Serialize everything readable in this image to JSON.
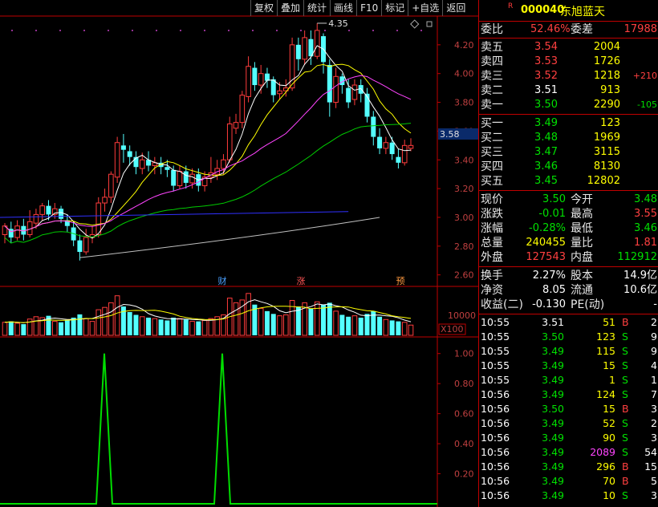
{
  "toolbar": [
    "复权",
    "叠加",
    "统计",
    "画线",
    "F10",
    "标记",
    "+自选",
    "返回"
  ],
  "stock": {
    "r_mark": "R",
    "code": "000040",
    "name": "东旭蓝天"
  },
  "order_ratio": {
    "wb_label": "委比",
    "wb_value": "52.46%",
    "wc_label": "委差",
    "wc_value": "17988"
  },
  "asks": [
    {
      "label": "卖五",
      "price": "3.54",
      "vol": "2004",
      "chg": ""
    },
    {
      "label": "卖四",
      "price": "3.53",
      "vol": "1726",
      "chg": ""
    },
    {
      "label": "卖三",
      "price": "3.52",
      "vol": "1218",
      "chg": "+210"
    },
    {
      "label": "卖二",
      "price": "3.51",
      "vol": "913",
      "chg": ""
    },
    {
      "label": "卖一",
      "price": "3.50",
      "vol": "2290",
      "chg": "-105"
    }
  ],
  "bids": [
    {
      "label": "买一",
      "price": "3.49",
      "vol": "123"
    },
    {
      "label": "买二",
      "price": "3.48",
      "vol": "1969"
    },
    {
      "label": "买三",
      "price": "3.47",
      "vol": "3115"
    },
    {
      "label": "买四",
      "price": "3.46",
      "vol": "8130"
    },
    {
      "label": "买五",
      "price": "3.45",
      "vol": "12802"
    }
  ],
  "quote": [
    {
      "l1": "现价",
      "v1": "3.50",
      "l2": "今开",
      "v2": "3.48"
    },
    {
      "l1": "涨跌",
      "v1": "-0.01",
      "l2": "最高",
      "v2": "3.55"
    },
    {
      "l1": "涨幅",
      "v1": "-0.28%",
      "l2": "最低",
      "v2": "3.46"
    },
    {
      "l1": "总量",
      "v1": "240455",
      "l2": "量比",
      "v2": "1.81"
    },
    {
      "l1": "外盘",
      "v1": "127543",
      "l2": "内盘",
      "v2": "112912"
    }
  ],
  "stats": [
    {
      "l1": "换手",
      "v1": "2.27%",
      "l2": "股本",
      "v2": "14.9亿"
    },
    {
      "l1": "净资",
      "v1": "8.05",
      "l2": "流通",
      "v2": "10.6亿"
    },
    {
      "l1": "收益(二)",
      "v1": "-0.130",
      "l2": "PE(动)",
      "v2": "-"
    }
  ],
  "ticks": [
    {
      "time": "10:55",
      "price": "3.51",
      "vol": "51",
      "dir": "B",
      "n": "2"
    },
    {
      "time": "10:55",
      "price": "3.50",
      "vol": "123",
      "dir": "S",
      "n": "9"
    },
    {
      "time": "10:55",
      "price": "3.49",
      "vol": "115",
      "dir": "S",
      "n": "9"
    },
    {
      "time": "10:55",
      "price": "3.49",
      "vol": "15",
      "dir": "S",
      "n": "4"
    },
    {
      "time": "10:55",
      "price": "3.49",
      "vol": "1",
      "dir": "S",
      "n": "1"
    },
    {
      "time": "10:56",
      "price": "3.49",
      "vol": "124",
      "dir": "S",
      "n": "7"
    },
    {
      "time": "10:56",
      "price": "3.50",
      "vol": "15",
      "dir": "B",
      "n": "3"
    },
    {
      "time": "10:56",
      "price": "3.49",
      "vol": "52",
      "dir": "S",
      "n": "2"
    },
    {
      "time": "10:56",
      "price": "3.49",
      "vol": "90",
      "dir": "S",
      "n": "3"
    },
    {
      "time": "10:56",
      "price": "3.49",
      "vol": "2089",
      "dir": "S",
      "n": "54"
    },
    {
      "time": "10:56",
      "price": "3.49",
      "vol": "296",
      "dir": "B",
      "n": "15"
    },
    {
      "time": "10:56",
      "price": "3.49",
      "vol": "70",
      "dir": "B",
      "n": "5"
    },
    {
      "time": "10:56",
      "price": "3.49",
      "vol": "10",
      "dir": "S",
      "n": "3"
    }
  ],
  "chart_data": {
    "type": "candlestick",
    "price_axis": {
      "ticks": [
        "4.20",
        "4.00",
        "3.80",
        "3.60",
        "3.40",
        "3.20",
        "3.00",
        "2.80",
        "2.60"
      ],
      "range": [
        2.52,
        4.4
      ],
      "current_price_label": "3.58"
    },
    "max_label": "4.35",
    "event_markers": [
      "财",
      "涨",
      "预"
    ],
    "volume_axis": {
      "tick": "10000",
      "unit": "X100"
    },
    "indicator_axis": {
      "ticks": [
        "1.00",
        "0.80",
        "0.60",
        "0.40",
        "0.20"
      ],
      "range": [
        0,
        1.1
      ]
    },
    "candles": [
      [
        2.88,
        2.94,
        2.82,
        2.96
      ],
      [
        2.92,
        2.86,
        2.82,
        2.97
      ],
      [
        2.86,
        2.94,
        2.84,
        2.98
      ],
      [
        2.94,
        2.88,
        2.84,
        2.99
      ],
      [
        2.88,
        2.97,
        2.86,
        3.05
      ],
      [
        2.96,
        3.02,
        2.92,
        3.06
      ],
      [
        3.02,
        3.08,
        2.98,
        3.1
      ],
      [
        3.08,
        3.02,
        2.98,
        3.12
      ],
      [
        3.02,
        3.06,
        2.99,
        3.1
      ],
      [
        3.06,
        2.99,
        2.96,
        3.08
      ],
      [
        2.98,
        2.94,
        2.9,
        3.02
      ],
      [
        2.93,
        2.84,
        2.8,
        2.97
      ],
      [
        2.84,
        2.76,
        2.7,
        2.88
      ],
      [
        2.76,
        2.86,
        2.74,
        2.92
      ],
      [
        2.86,
        2.88,
        2.82,
        2.94
      ],
      [
        2.88,
        3.1,
        2.86,
        3.14
      ],
      [
        3.1,
        3.14,
        3.04,
        3.2
      ],
      [
        3.14,
        3.3,
        3.1,
        3.32
      ],
      [
        3.28,
        3.52,
        3.24,
        3.56
      ],
      [
        3.5,
        3.47,
        3.38,
        3.58
      ],
      [
        3.46,
        3.42,
        3.36,
        3.5
      ],
      [
        3.42,
        3.35,
        3.3,
        3.46
      ],
      [
        3.34,
        3.4,
        3.3,
        3.45
      ],
      [
        3.4,
        3.36,
        3.32,
        3.46
      ],
      [
        3.36,
        3.38,
        3.3,
        3.42
      ],
      [
        3.38,
        3.35,
        3.3,
        3.42
      ],
      [
        3.35,
        3.33,
        3.28,
        3.4
      ],
      [
        3.33,
        3.22,
        3.18,
        3.36
      ],
      [
        3.22,
        3.32,
        3.2,
        3.36
      ],
      [
        3.32,
        3.24,
        3.2,
        3.36
      ],
      [
        3.24,
        3.3,
        3.2,
        3.34
      ],
      [
        3.3,
        3.22,
        3.18,
        3.34
      ],
      [
        3.22,
        3.28,
        3.18,
        3.32
      ],
      [
        3.28,
        3.31,
        3.24,
        3.42
      ],
      [
        3.3,
        3.34,
        3.26,
        3.4
      ],
      [
        3.34,
        3.4,
        3.3,
        3.44
      ],
      [
        3.4,
        3.65,
        3.38,
        3.7
      ],
      [
        3.62,
        3.66,
        3.58,
        3.72
      ],
      [
        3.66,
        3.85,
        3.62,
        3.88
      ],
      [
        3.84,
        4.05,
        3.8,
        4.12
      ],
      [
        4.04,
        3.92,
        3.88,
        4.08
      ],
      [
        3.92,
        4.0,
        3.86,
        4.06
      ],
      [
        4.0,
        3.95,
        3.9,
        4.04
      ],
      [
        3.96,
        3.85,
        3.8,
        3.98
      ],
      [
        3.86,
        3.88,
        3.82,
        3.94
      ],
      [
        3.88,
        3.9,
        3.84,
        3.96
      ],
      [
        3.9,
        4.2,
        3.88,
        4.25
      ],
      [
        4.2,
        4.1,
        4.02,
        4.25
      ],
      [
        4.1,
        4.25,
        4.06,
        4.3
      ],
      [
        4.24,
        4.12,
        4.06,
        4.3
      ],
      [
        4.12,
        4.3,
        4.1,
        4.35
      ],
      [
        4.26,
        4.08,
        4.0,
        4.28
      ],
      [
        4.06,
        3.8,
        3.7,
        4.1
      ],
      [
        3.8,
        3.98,
        3.76,
        4.04
      ],
      [
        3.98,
        3.92,
        3.86,
        4.0
      ],
      [
        3.9,
        3.8,
        3.76,
        3.96
      ],
      [
        3.82,
        3.92,
        3.78,
        3.96
      ],
      [
        3.92,
        3.86,
        3.8,
        3.96
      ],
      [
        3.86,
        3.7,
        3.66,
        3.9
      ],
      [
        3.7,
        3.56,
        3.5,
        3.74
      ],
      [
        3.56,
        3.48,
        3.44,
        3.62
      ],
      [
        3.48,
        3.52,
        3.44,
        3.56
      ],
      [
        3.52,
        3.44,
        3.4,
        3.56
      ],
      [
        3.42,
        3.38,
        3.34,
        3.48
      ],
      [
        3.38,
        3.5,
        3.36,
        3.54
      ],
      [
        3.48,
        3.5,
        3.46,
        3.55
      ]
    ],
    "volumes": [
      28,
      30,
      26,
      24,
      35,
      40,
      38,
      42,
      30,
      28,
      32,
      38,
      45,
      36,
      30,
      55,
      60,
      70,
      85,
      62,
      50,
      44,
      40,
      38,
      36,
      34,
      32,
      38,
      36,
      34,
      30,
      30,
      32,
      36,
      40,
      44,
      80,
      70,
      76,
      90,
      66,
      58,
      52,
      46,
      42,
      44,
      75,
      62,
      70,
      58,
      72,
      66,
      70,
      52,
      44,
      40,
      42,
      38,
      46,
      52,
      40,
      34,
      32,
      30,
      28,
      22
    ],
    "indicator": {
      "values": [
        0,
        0,
        0,
        0,
        0,
        0,
        0,
        0,
        0,
        0,
        0,
        0,
        0,
        0,
        0,
        0,
        0,
        0,
        0,
        0,
        0,
        0,
        0,
        0,
        0,
        0,
        0,
        0,
        0,
        0,
        0,
        0,
        0,
        0,
        0,
        0,
        0,
        1,
        0,
        0,
        0,
        0,
        0,
        0,
        0,
        0,
        0,
        0,
        0,
        0,
        0,
        0,
        0,
        0,
        0,
        0,
        0,
        0,
        0,
        0,
        0,
        0,
        0,
        0,
        0,
        0
      ],
      "spikes_at_index": [
        16,
        37
      ]
    }
  }
}
